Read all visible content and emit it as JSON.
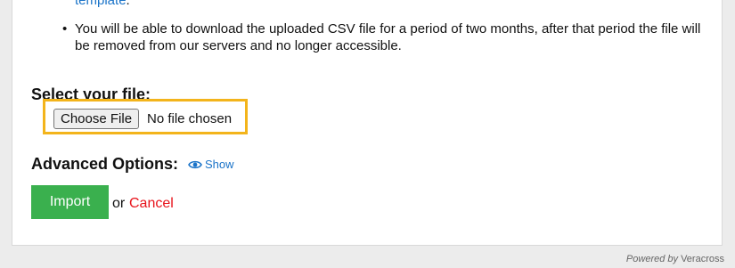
{
  "instructions": {
    "continued_link": "template",
    "continued_suffix": ".",
    "bullet": "You will be able to download the uploaded CSV file for a period of two months, after that period the file will be removed from our servers and no longer accessible."
  },
  "file_select": {
    "label": "Select your file:",
    "button_label": "Choose File",
    "status": "No file chosen"
  },
  "advanced": {
    "label": "Advanced Options:",
    "show_label": "Show",
    "icon": "eye-icon"
  },
  "actions": {
    "import_label": "Import",
    "or_text": "or",
    "cancel_label": "Cancel"
  },
  "footer": {
    "powered_by": "Powered by",
    "brand": "Veracross"
  },
  "colors": {
    "link": "#1a73c8",
    "highlight": "#f3b41b",
    "import_button": "#3ab04e",
    "cancel": "#e8131b"
  }
}
